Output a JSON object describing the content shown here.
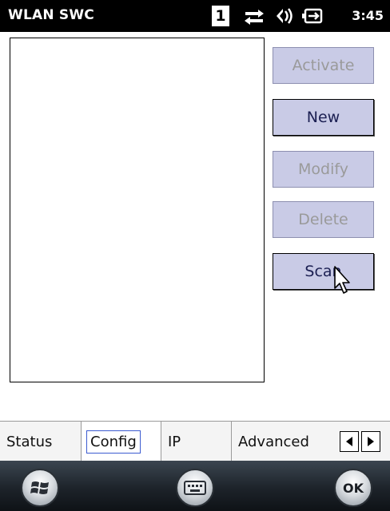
{
  "titlebar": {
    "app_title": "WLAN SWC",
    "sim_badge": "1",
    "clock": "3:45",
    "icons": [
      "connectivity-arrows-icon",
      "speaker-icon",
      "battery-charging-icon"
    ]
  },
  "network_list": {
    "items": []
  },
  "buttons": [
    {
      "label": "Activate",
      "enabled": false
    },
    {
      "label": "New",
      "enabled": true
    },
    {
      "label": "Modify",
      "enabled": false
    },
    {
      "label": "Delete",
      "enabled": false
    },
    {
      "label": "Scan",
      "enabled": true
    }
  ],
  "tabs": [
    {
      "label": "Status",
      "active": false
    },
    {
      "label": "Config",
      "active": true
    },
    {
      "label": "IP",
      "active": false
    },
    {
      "label": "Advanced",
      "active": false
    }
  ],
  "softkeys": {
    "start_icon": "windows-start-icon",
    "keyboard_icon": "keyboard-icon",
    "ok_label": "OK"
  },
  "colors": {
    "button_fill": "#c9cbe6",
    "enabled_text": "#1b1f52",
    "disabled_text": "#9a9a9a",
    "tab_focus": "#3c5bd0"
  }
}
